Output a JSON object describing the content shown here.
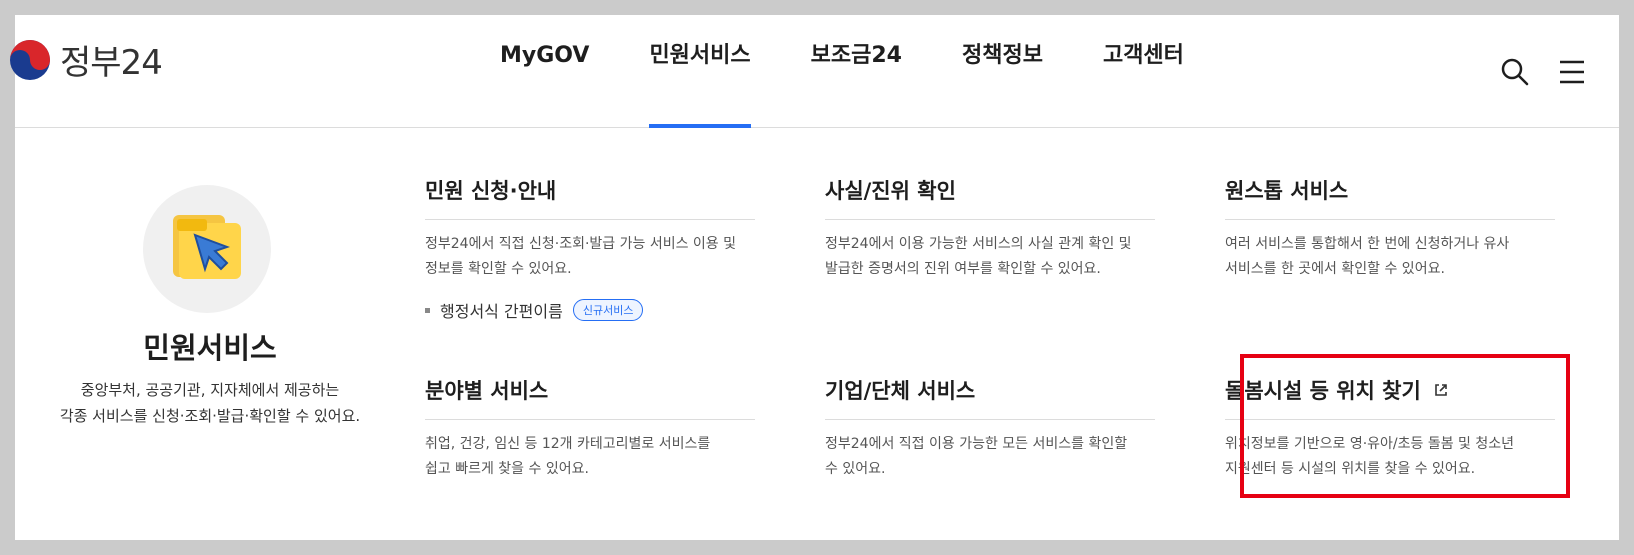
{
  "header": {
    "logo_text": "정부24",
    "nav": [
      "MyGOV",
      "민원서비스",
      "보조금24",
      "정책정보",
      "고객센터"
    ],
    "active_nav": "민원서비스",
    "icons": [
      "search-icon",
      "hamburger-menu-icon"
    ]
  },
  "left_panel": {
    "title": "민원서비스",
    "desc_line1": "중앙부처, 공공기관, 지자체에서 제공하는",
    "desc_line2": "각종 서비스를 신청·조회·발급·확인할 수 있어요."
  },
  "cards": {
    "c1": {
      "title": "민원 신청·안내",
      "desc_line1": "정부24에서 직접 신청·조회·발급 가능 서비스 이용 및",
      "desc_line2": "정보를 확인할 수 있어요.",
      "link_text": "행정서식 간편이름",
      "badge": "신규서비스"
    },
    "c2": {
      "title": "사실/진위 확인",
      "desc_line1": "정부24에서 이용 가능한 서비스의 사실 관계 확인 및",
      "desc_line2": "발급한 증명서의 진위 여부를 확인할 수 있어요."
    },
    "c3": {
      "title": "원스톱 서비스",
      "desc_line1": "여러 서비스를 통합해서 한 번에 신청하거나 유사",
      "desc_line2": "서비스를 한 곳에서 확인할 수 있어요."
    },
    "c4": {
      "title": "분야별 서비스",
      "desc_line1": "취업, 건강, 임신 등 12개 카테고리별로 서비스를",
      "desc_line2": "쉽고 빠르게 찾을 수 있어요."
    },
    "c5": {
      "title": "기업/단체 서비스",
      "desc_line1": "정부24에서 직접 이용 가능한 모든 서비스를 확인할",
      "desc_line2": "수 있어요."
    },
    "c6": {
      "title": "돌봄시설 등 위치 찾기",
      "desc_line1": "위치정보를 기반으로 영·유아/초등 돌봄 및 청소년",
      "desc_line2": "지원센터 등 시설의 위치를 찾을 수 있어요."
    }
  },
  "colors": {
    "accent": "#256ef4",
    "highlight": "#e60012"
  }
}
